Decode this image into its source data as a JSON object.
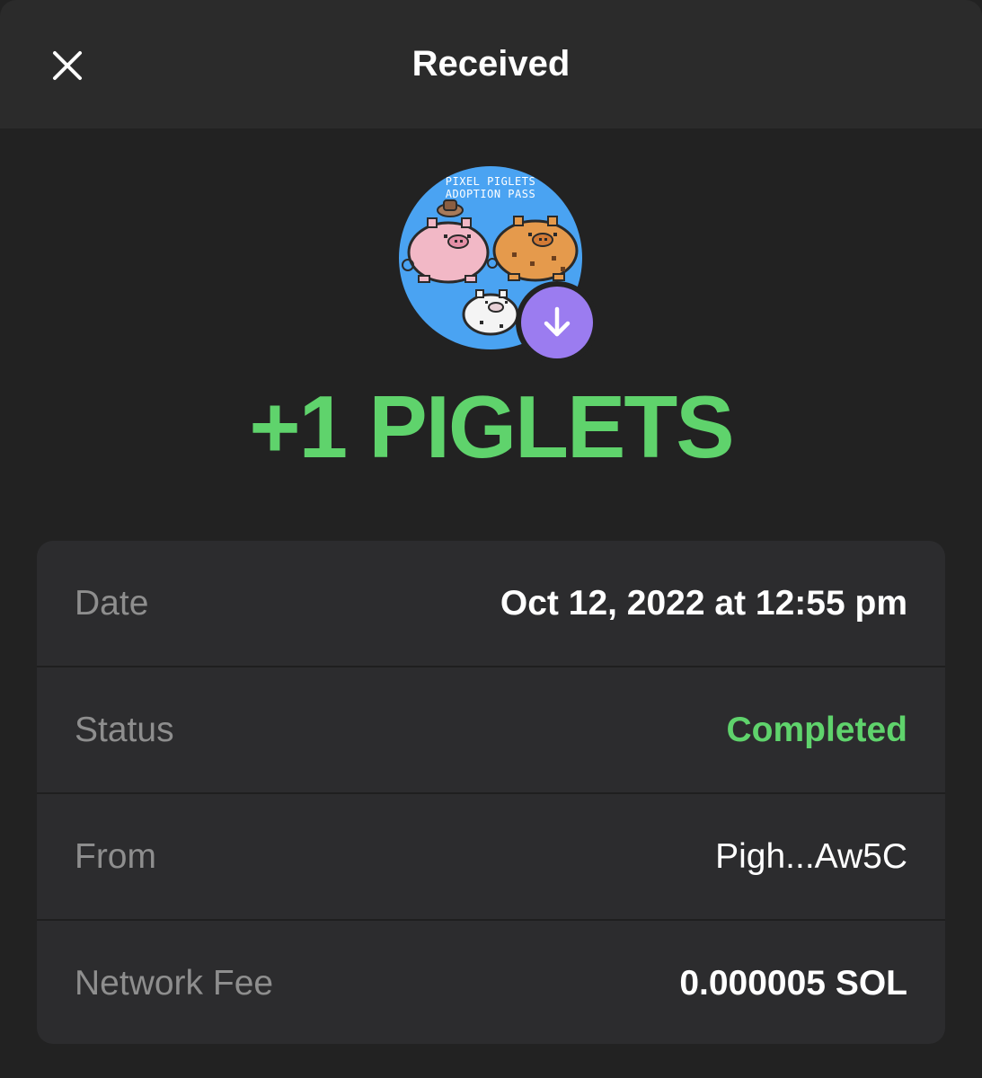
{
  "header": {
    "title": "Received",
    "close_icon": "close-icon"
  },
  "nft": {
    "caption_line1": "PIXEL PIGLETS",
    "caption_line2": "ADOPTION PASS",
    "background_color": "#4aa3f2",
    "badge_icon": "arrow-down-icon",
    "badge_color": "#9b7cf0"
  },
  "amount": "+1 PIGLETS",
  "details": [
    {
      "label": "Date",
      "value": "Oct 12, 2022 at 12:55 pm"
    },
    {
      "label": "Status",
      "value": "Completed"
    },
    {
      "label": "From",
      "value": "Pigh...Aw5C"
    },
    {
      "label": "Network Fee",
      "value": "0.000005 SOL"
    }
  ],
  "colors": {
    "background": "#222222",
    "header": "#2b2b2b",
    "card": "#2c2c2e",
    "success": "#5fd36c",
    "muted": "#8e8e8e"
  }
}
